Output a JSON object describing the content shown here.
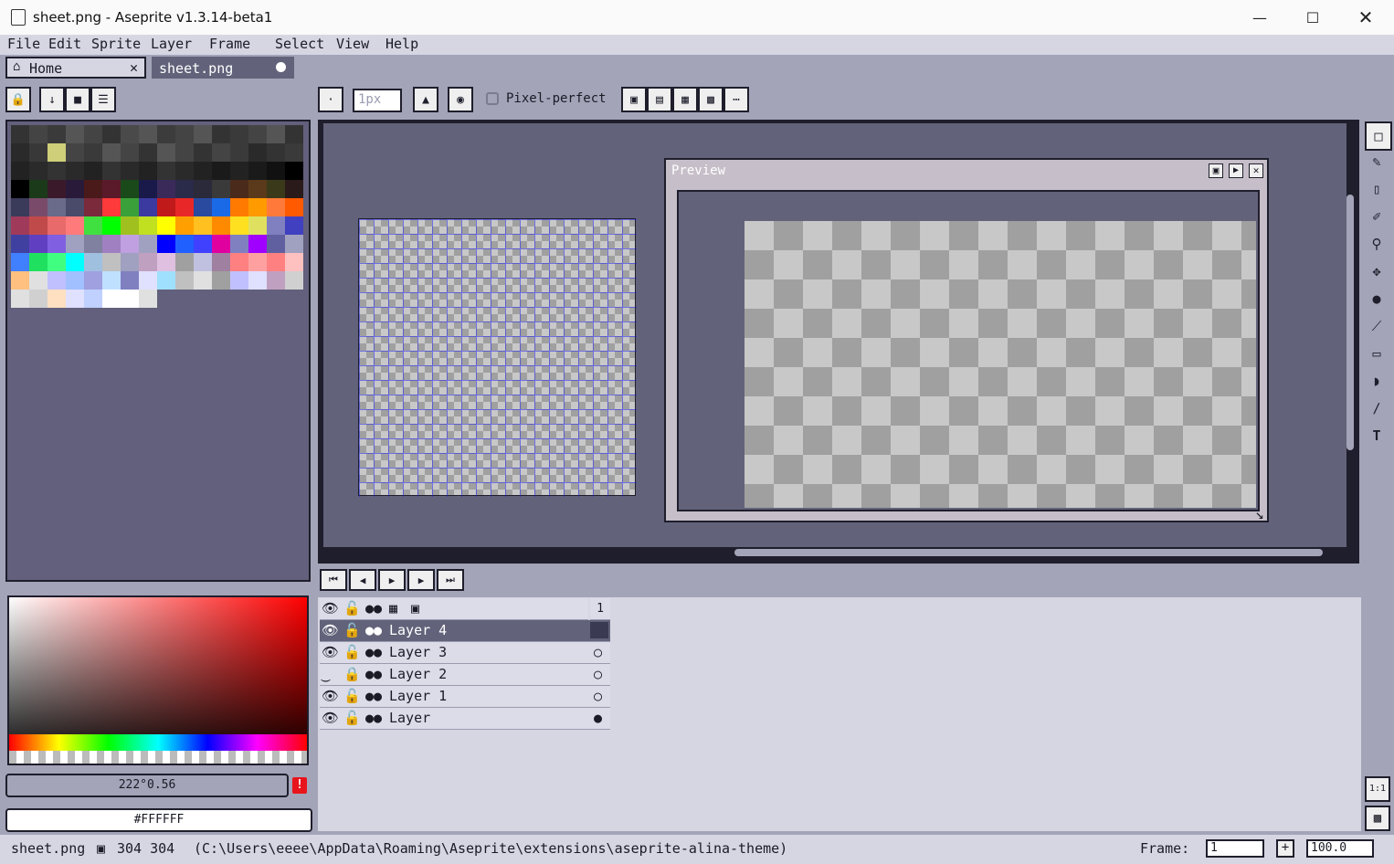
{
  "window": {
    "title": "sheet.png - Aseprite v1.3.14-beta1"
  },
  "menu": [
    "File",
    "Edit",
    "Sprite",
    "Layer",
    "Frame",
    "Select",
    "View",
    "Help"
  ],
  "tabs": [
    {
      "label": "Home"
    },
    {
      "label": "sheet.png"
    }
  ],
  "toolbar": {
    "brush_size": "1px",
    "pixel_perfect_label": "Pixel-perfect"
  },
  "preview": {
    "title": "Preview"
  },
  "timeline": {
    "frame_header": "1",
    "layers": [
      {
        "name": "Layer 4",
        "selected": true,
        "locked": false,
        "visible": true
      },
      {
        "name": "Layer 3",
        "selected": false,
        "locked": false,
        "visible": true
      },
      {
        "name": "Layer 2",
        "selected": false,
        "locked": true,
        "visible": false
      },
      {
        "name": "Layer 1",
        "selected": false,
        "locked": false,
        "visible": true
      },
      {
        "name": "Layer",
        "selected": false,
        "locked": false,
        "visible": true
      }
    ]
  },
  "color": {
    "hsv_text": "222°0.56",
    "hex": "#FFFFFF"
  },
  "status": {
    "filename": "sheet.png",
    "size": "304 304",
    "path": "(C:\\Users\\eeee\\AppData\\Roaming\\Aseprite\\extensions\\aseprite-alina-theme)",
    "frame_label": "Frame:",
    "frame_value": "1",
    "zoom": "100.0"
  },
  "zoom_buttons": {
    "one_to_one": "1:1"
  }
}
